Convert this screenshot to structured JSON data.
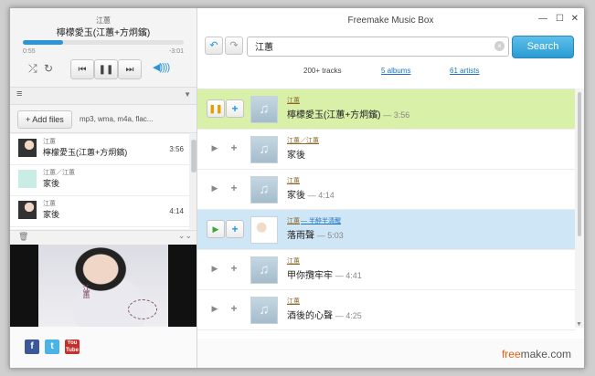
{
  "window": {
    "title": "Freemake Music Box"
  },
  "player": {
    "artist": "江蕙",
    "title": "檸檬愛玉(江蕙+方炯鑌)",
    "elapsed": "0:55",
    "remaining": "-3:01",
    "progress_fraction": 0.25
  },
  "sidebar": {
    "section_label": "",
    "add_files_label": "+  Add files",
    "formats": "mp3, wma, m4a, flac..."
  },
  "playlist": [
    {
      "artist": "江蕙",
      "title": "檸檬愛玉(江蕙+方炯鑌)",
      "duration": "3:56"
    },
    {
      "artist": "江蕙／江蕙",
      "title": "家後",
      "duration": ""
    },
    {
      "artist": "江蕙",
      "title": "家後",
      "duration": "4:14"
    }
  ],
  "cover": {
    "text": "江蕙"
  },
  "search": {
    "value": "江蕙",
    "button": "Search"
  },
  "tabs": {
    "tracks": "200+ tracks",
    "albums": "5 albums",
    "artists": "61 artists"
  },
  "results": [
    {
      "artist": "江蕙",
      "title": "檸檬愛玉(江蕙+方炯鑌)",
      "duration": "— 3:56"
    },
    {
      "artist": "江蕙／江蕙",
      "title": "家後",
      "duration": ""
    },
    {
      "artist": "江蕙",
      "title": "家後",
      "duration": "— 4:14"
    },
    {
      "artist": "江蕙",
      "artist_extra": "— 半醉半清醒",
      "title": "落雨聲",
      "duration": "— 5:03"
    },
    {
      "artist": "江蕙",
      "title": "甲你攬牢牢",
      "duration": "— 4:41"
    },
    {
      "artist": "江蕙",
      "title": "酒後的心聲",
      "duration": "— 4:25"
    }
  ],
  "social": {
    "fb": "f",
    "tw": "t",
    "yt": "You\nTube"
  },
  "brand": {
    "part1": "free",
    "part2": "make.com"
  },
  "colors": {
    "accent": "#2b95d6",
    "playing_row": "#d8f0a8",
    "selected_row": "#cfe6f6",
    "brand_orange": "#e85c0d"
  }
}
